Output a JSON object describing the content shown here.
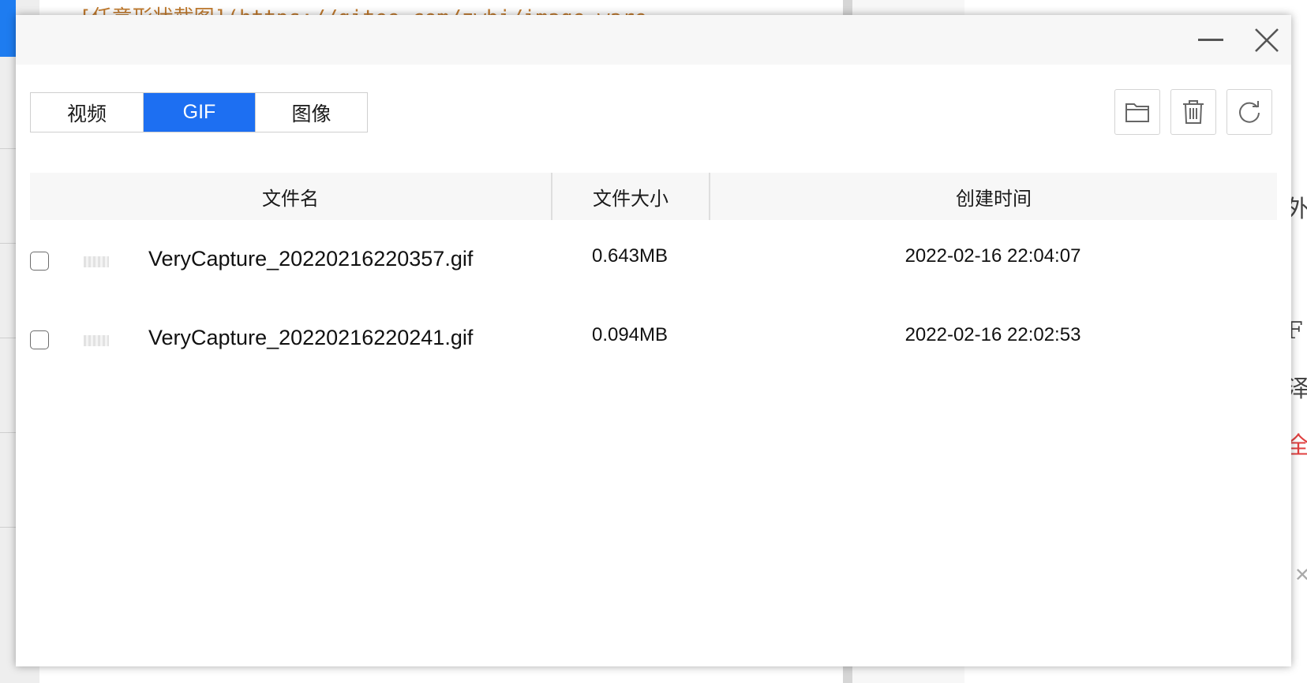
{
  "background": {
    "code_line": "[任意形状截图](https://gitee.com/zwbi/image-ware",
    "right_fragments": [
      "外",
      "F",
      "泽",
      "全"
    ]
  },
  "dialog": {
    "tabs": [
      {
        "label": "视频",
        "active": false
      },
      {
        "label": "GIF",
        "active": true
      },
      {
        "label": "图像",
        "active": false
      }
    ],
    "toolbar": {
      "open_folder_icon": "folder-icon",
      "delete_icon": "trash-icon",
      "refresh_icon": "refresh-icon"
    },
    "table": {
      "columns": [
        "文件名",
        "文件大小",
        "创建时间"
      ],
      "rows": [
        {
          "checked": false,
          "name": "VeryCapture_20220216220357.gif",
          "size": "0.643MB",
          "created": "2022-02-16 22:04:07"
        },
        {
          "checked": false,
          "name": "VeryCapture_20220216220241.gif",
          "size": "0.094MB",
          "created": "2022-02-16 22:02:53"
        }
      ]
    },
    "colors": {
      "accent": "#1d6ff2",
      "titlebar": "#f7f7f7",
      "header_bg": "#f7f7f7"
    }
  }
}
